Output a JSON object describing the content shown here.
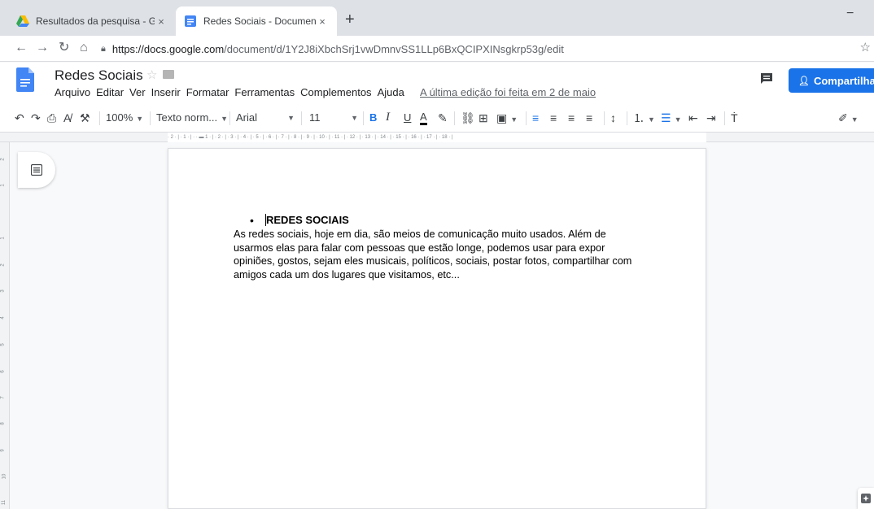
{
  "browser": {
    "tabs": [
      {
        "title": "Resultados da pesquisa - Google",
        "close": "×"
      },
      {
        "title": "Redes Sociais - Documentos Goo",
        "close": "×"
      }
    ],
    "new_tab": "+",
    "minimize": "−",
    "url_domain": "https://docs.google.com",
    "url_path": "/document/d/1Y2J8iXbchSrj1vwDmnvSS1LLp6BxQCIPXINsgkrp53g/edit"
  },
  "doc": {
    "title": "Redes Sociais",
    "menu": [
      "Arquivo",
      "Editar",
      "Ver",
      "Inserir",
      "Formatar",
      "Ferramentas",
      "Complementos",
      "Ajuda"
    ],
    "last_edit": "A última edição foi feita em 2 de maio",
    "share_label": "Compartilhar"
  },
  "toolbar": {
    "zoom": "100%",
    "style": "Texto norm...",
    "font": "Arial",
    "size": "11",
    "bold": "B",
    "italic": "I",
    "underline": "U",
    "text_color": "A"
  },
  "ruler": {
    "h": "· 2 · | · 1 · | · · ▬ 1 · | · 2 · | · 3 · | · 4 · | · 5 · | · 6 · | · 7 · | · 8 · | · 9 · | · 10 · | · 11 · | · 12 · | · 13 · | · 14 · | · 15 · | · 16 · | · 17 · | · 18 · |",
    "v": [
      "2",
      "1",
      "1",
      "2",
      "3",
      "4",
      "5",
      "6",
      "7",
      "8",
      "9",
      "10",
      "11"
    ]
  },
  "content": {
    "heading": "REDES SOCIAIS",
    "paragraph": " As redes sociais, hoje em dia, são meios de comunicação muito usados. Além de usarmos elas para falar com pessoas que estão longe, podemos usar para expor opiniões, gostos, sejam eles musicais, políticos, sociais, postar fotos, compartilhar com amigos cada um dos lugares que visitamos, etc..."
  },
  "colors": {
    "accent": "#1a73e8",
    "docs_blue": "#4285f4",
    "tabstrip": "#dee1e6"
  }
}
